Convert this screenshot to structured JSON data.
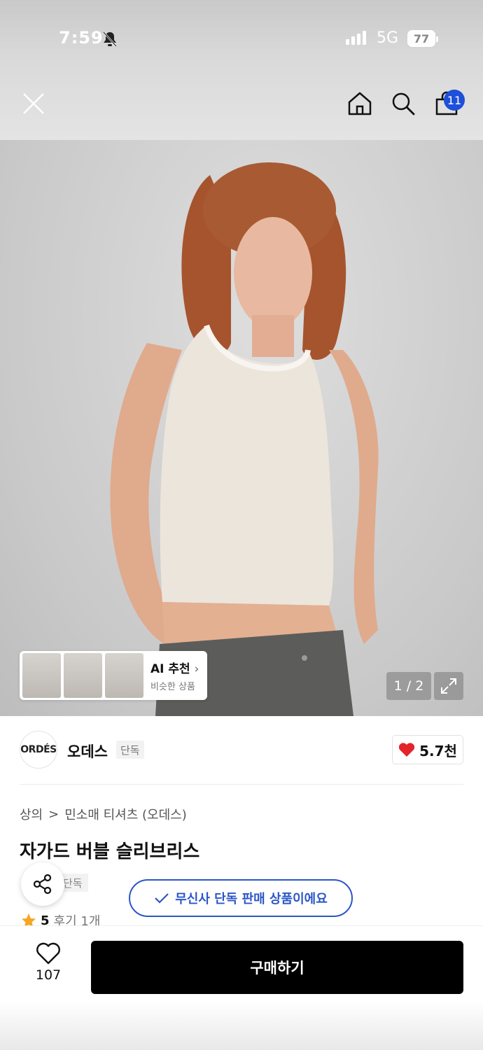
{
  "status_bar": {
    "time": "7:59",
    "network": "5G",
    "battery": "77"
  },
  "nav": {
    "cart_count": "11",
    "icons": [
      "close-icon",
      "home-icon",
      "search-icon",
      "cart-icon"
    ]
  },
  "gallery": {
    "ai_card_title": "AI 추천",
    "ai_card_sub": "비슷한 상품",
    "page_indicator": "1 / 2"
  },
  "brand": {
    "logo_text": "ORDÉS",
    "name": "오데스",
    "tag": "단독",
    "likes": "5.7천"
  },
  "breadcrumb": {
    "level1": "상의",
    "separator": ">",
    "level2": "민소매 티셔츠 (오데스)"
  },
  "product": {
    "title": "자가드 버블 슬리브리스",
    "exclusive_tag": "단독",
    "musinsa_notice": "무신사 단독 판매 상품이에요",
    "rating": "5",
    "reviews": "후기 1개"
  },
  "bottom": {
    "wish_count": "107",
    "buy_label": "구매하기"
  },
  "colors": {
    "accent_blue": "#2b56c8",
    "badge_blue": "#1e4fd8",
    "heart_red": "#e3242b",
    "buy_black": "#000000"
  }
}
